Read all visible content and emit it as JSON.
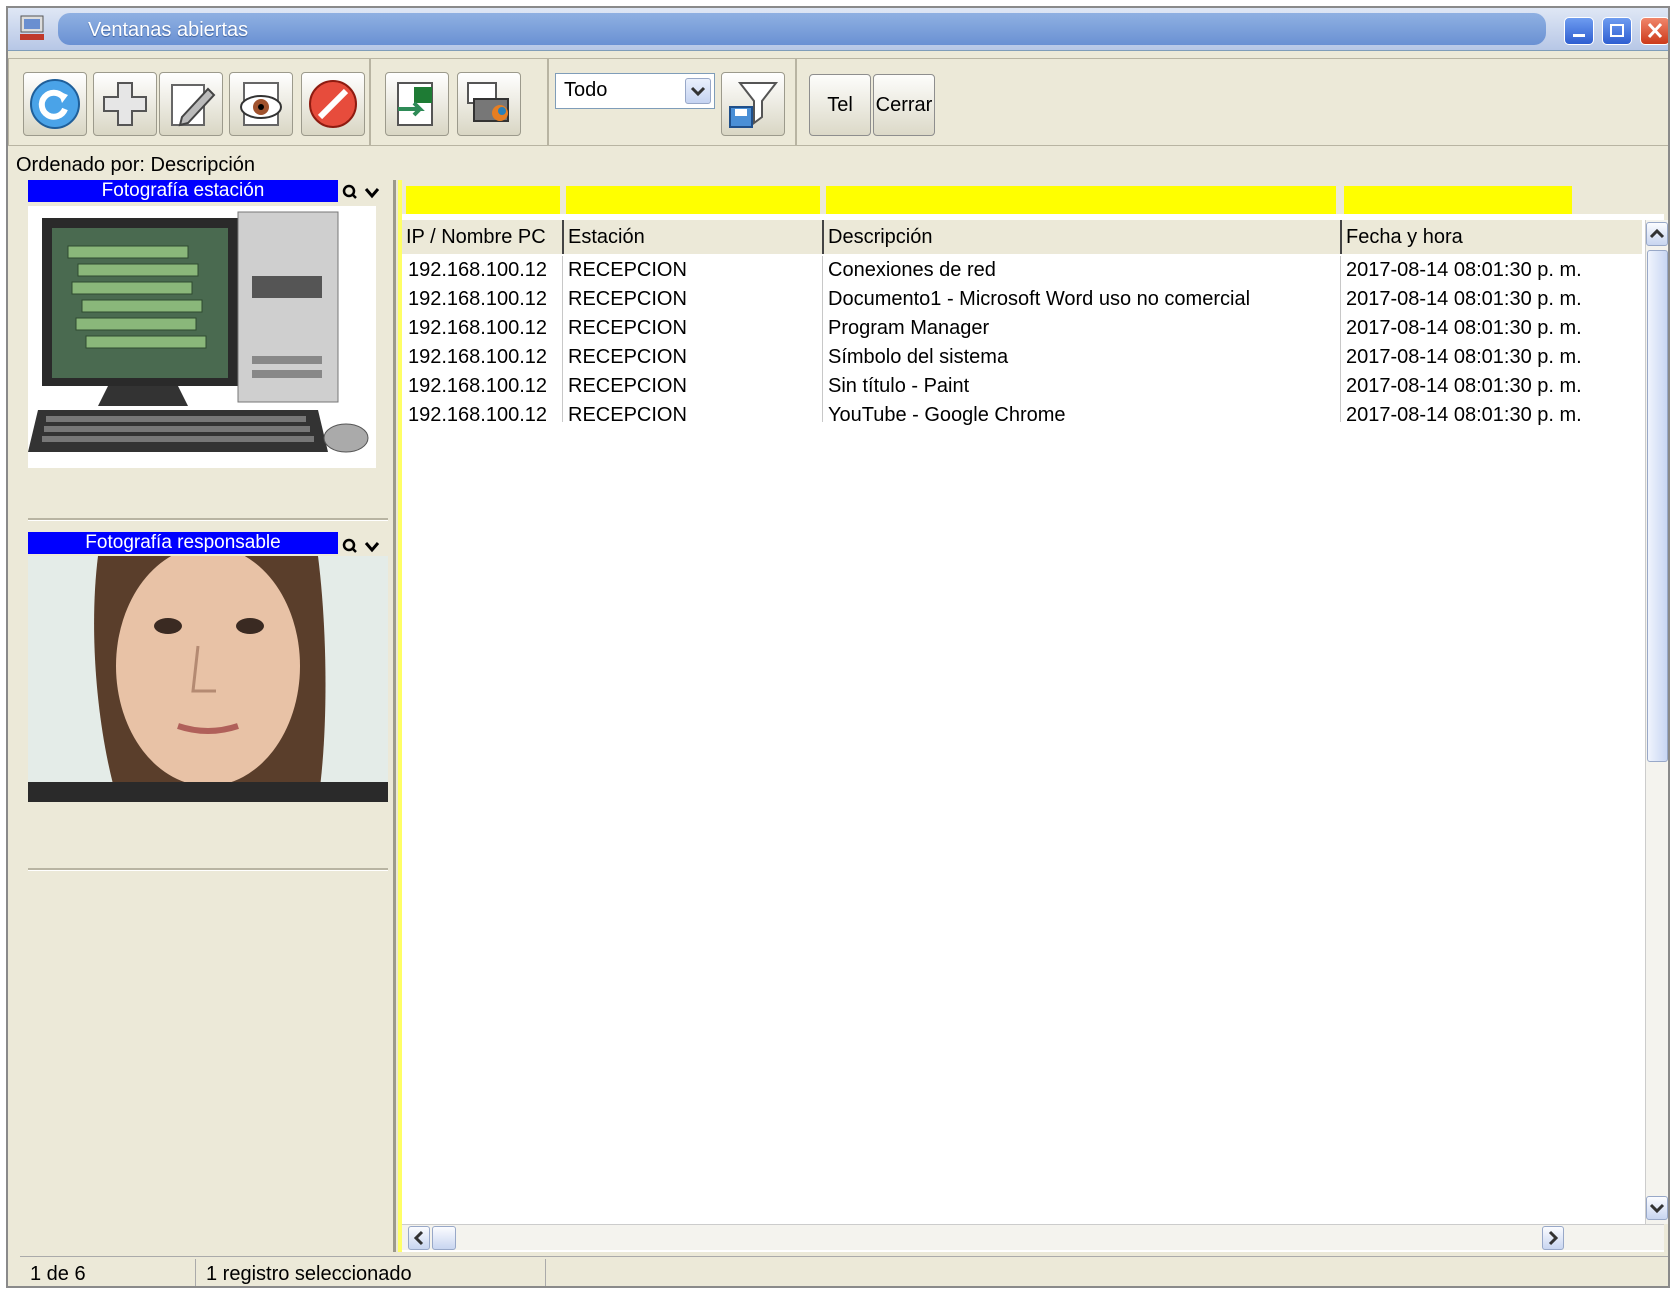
{
  "window": {
    "title": "Ventanas abiertas"
  },
  "toolbar": {
    "buttons": [
      "refresh-icon",
      "add-icon",
      "edit-icon",
      "view-icon",
      "delete-icon",
      "export-excel-icon",
      "print-icon"
    ],
    "filter_select": {
      "value": "Todo"
    },
    "filter_button": "filter-save-icon",
    "tel_label": "Tel",
    "close_label": "Cerrar"
  },
  "ordered_by": "Ordenado por: Descripción",
  "left_panel": {
    "station_photo_title": "Fotografía estación",
    "responsible_photo_title": "Fotografía responsable"
  },
  "table": {
    "columns": [
      "IP / Nombre PC",
      "Estación",
      "Descripción",
      "Fecha y hora"
    ],
    "rows": [
      [
        "192.168.100.12",
        "RECEPCION",
        "Conexiones de red",
        "2017-08-14 08:01:30 p. m."
      ],
      [
        "192.168.100.12",
        "RECEPCION",
        "Documento1 - Microsoft Word uso no comercial",
        "2017-08-14 08:01:30 p. m."
      ],
      [
        "192.168.100.12",
        "RECEPCION",
        "Program Manager",
        "2017-08-14 08:01:30 p. m."
      ],
      [
        "192.168.100.12",
        "RECEPCION",
        "Símbolo del sistema",
        "2017-08-14 08:01:30 p. m."
      ],
      [
        "192.168.100.12",
        "RECEPCION",
        "Sin título - Paint",
        "2017-08-14 08:01:30 p. m."
      ],
      [
        "192.168.100.12",
        "RECEPCION",
        "YouTube - Google Chrome",
        "2017-08-14 08:01:30 p. m."
      ]
    ]
  },
  "status": {
    "position": "1 de 6",
    "selection": "1 registro seleccionado"
  },
  "colors": {
    "filter_row": "#ffff00",
    "panel_header": "#0000ff",
    "window_bg": "#ece9d8"
  }
}
